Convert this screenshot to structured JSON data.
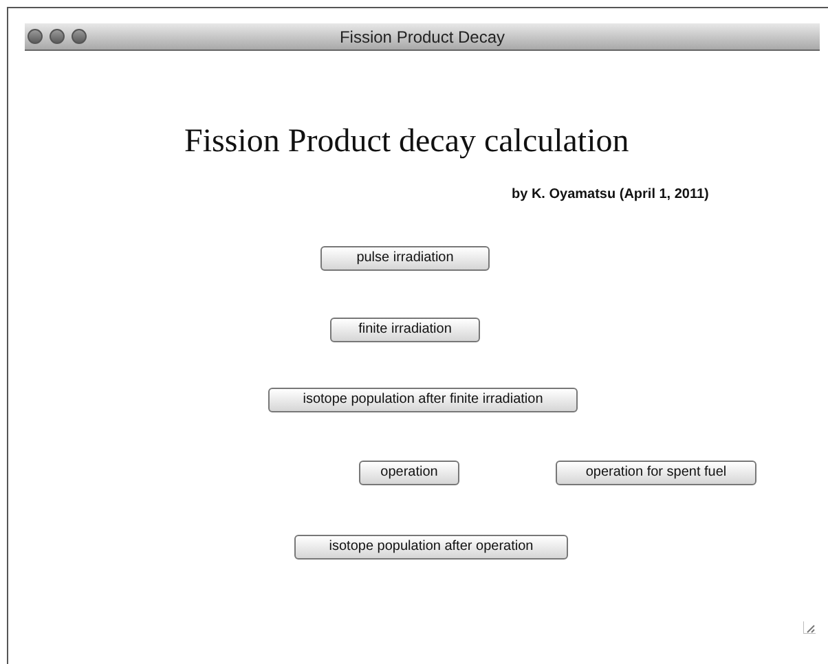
{
  "window": {
    "title": "Fission Product Decay"
  },
  "heading": "Fission Product decay calculation",
  "byline": "by K. Oyamatsu (April 1, 2011)",
  "button_rows": [
    [
      "pulse irradiation"
    ],
    [
      "finite irradiation"
    ],
    [
      "isotope population after finite irradiation"
    ],
    [
      "operation",
      "operation for spent fuel"
    ],
    [
      "isotope population after operation"
    ]
  ]
}
